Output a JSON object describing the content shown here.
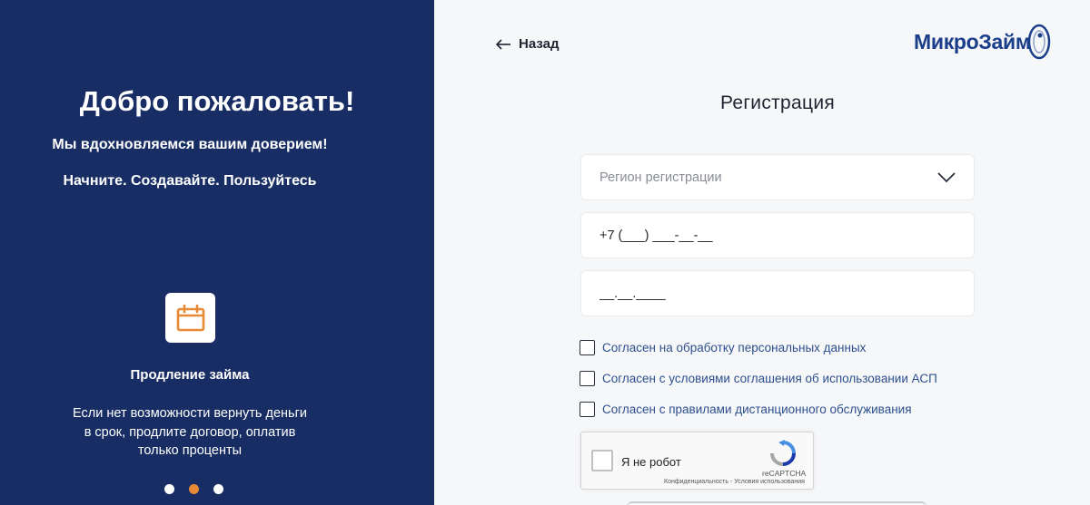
{
  "left": {
    "welcome": "Добро пожаловать!",
    "subtitle1": "Мы вдохновляемся вашим доверием!",
    "subtitle2": "Начните. Создавайте. Пользуйтесь",
    "feature": {
      "icon": "calendar-icon",
      "title": "Продление займа",
      "description": "Если нет возможности вернуть деньги в срок, продлите договор, оплатив только проценты"
    },
    "slider": {
      "count": 3,
      "active_index": 1
    }
  },
  "header": {
    "back_label": "Назад",
    "logo_text": "МикроЗайм"
  },
  "form": {
    "title": "Регистрация",
    "region_placeholder": "Регион регистрации",
    "phone_value": "+7 (___) ___-__-__",
    "date_value": "__.__.____",
    "checkboxes": [
      "Согласен на обработку персональных данных",
      "Согласен с условиями соглашения об использовании АСП",
      "Согласен с правилами дистанционного обслуживания"
    ],
    "captcha": {
      "label": "Я не робот",
      "brand": "reCAPTCHA",
      "terms": "Конфиденциальность - Условия использования"
    }
  },
  "colors": {
    "left_bg": "#172d64",
    "accent_orange": "#e88936",
    "link_blue": "#2d4f8e",
    "logo_blue": "#1b3e8a"
  }
}
